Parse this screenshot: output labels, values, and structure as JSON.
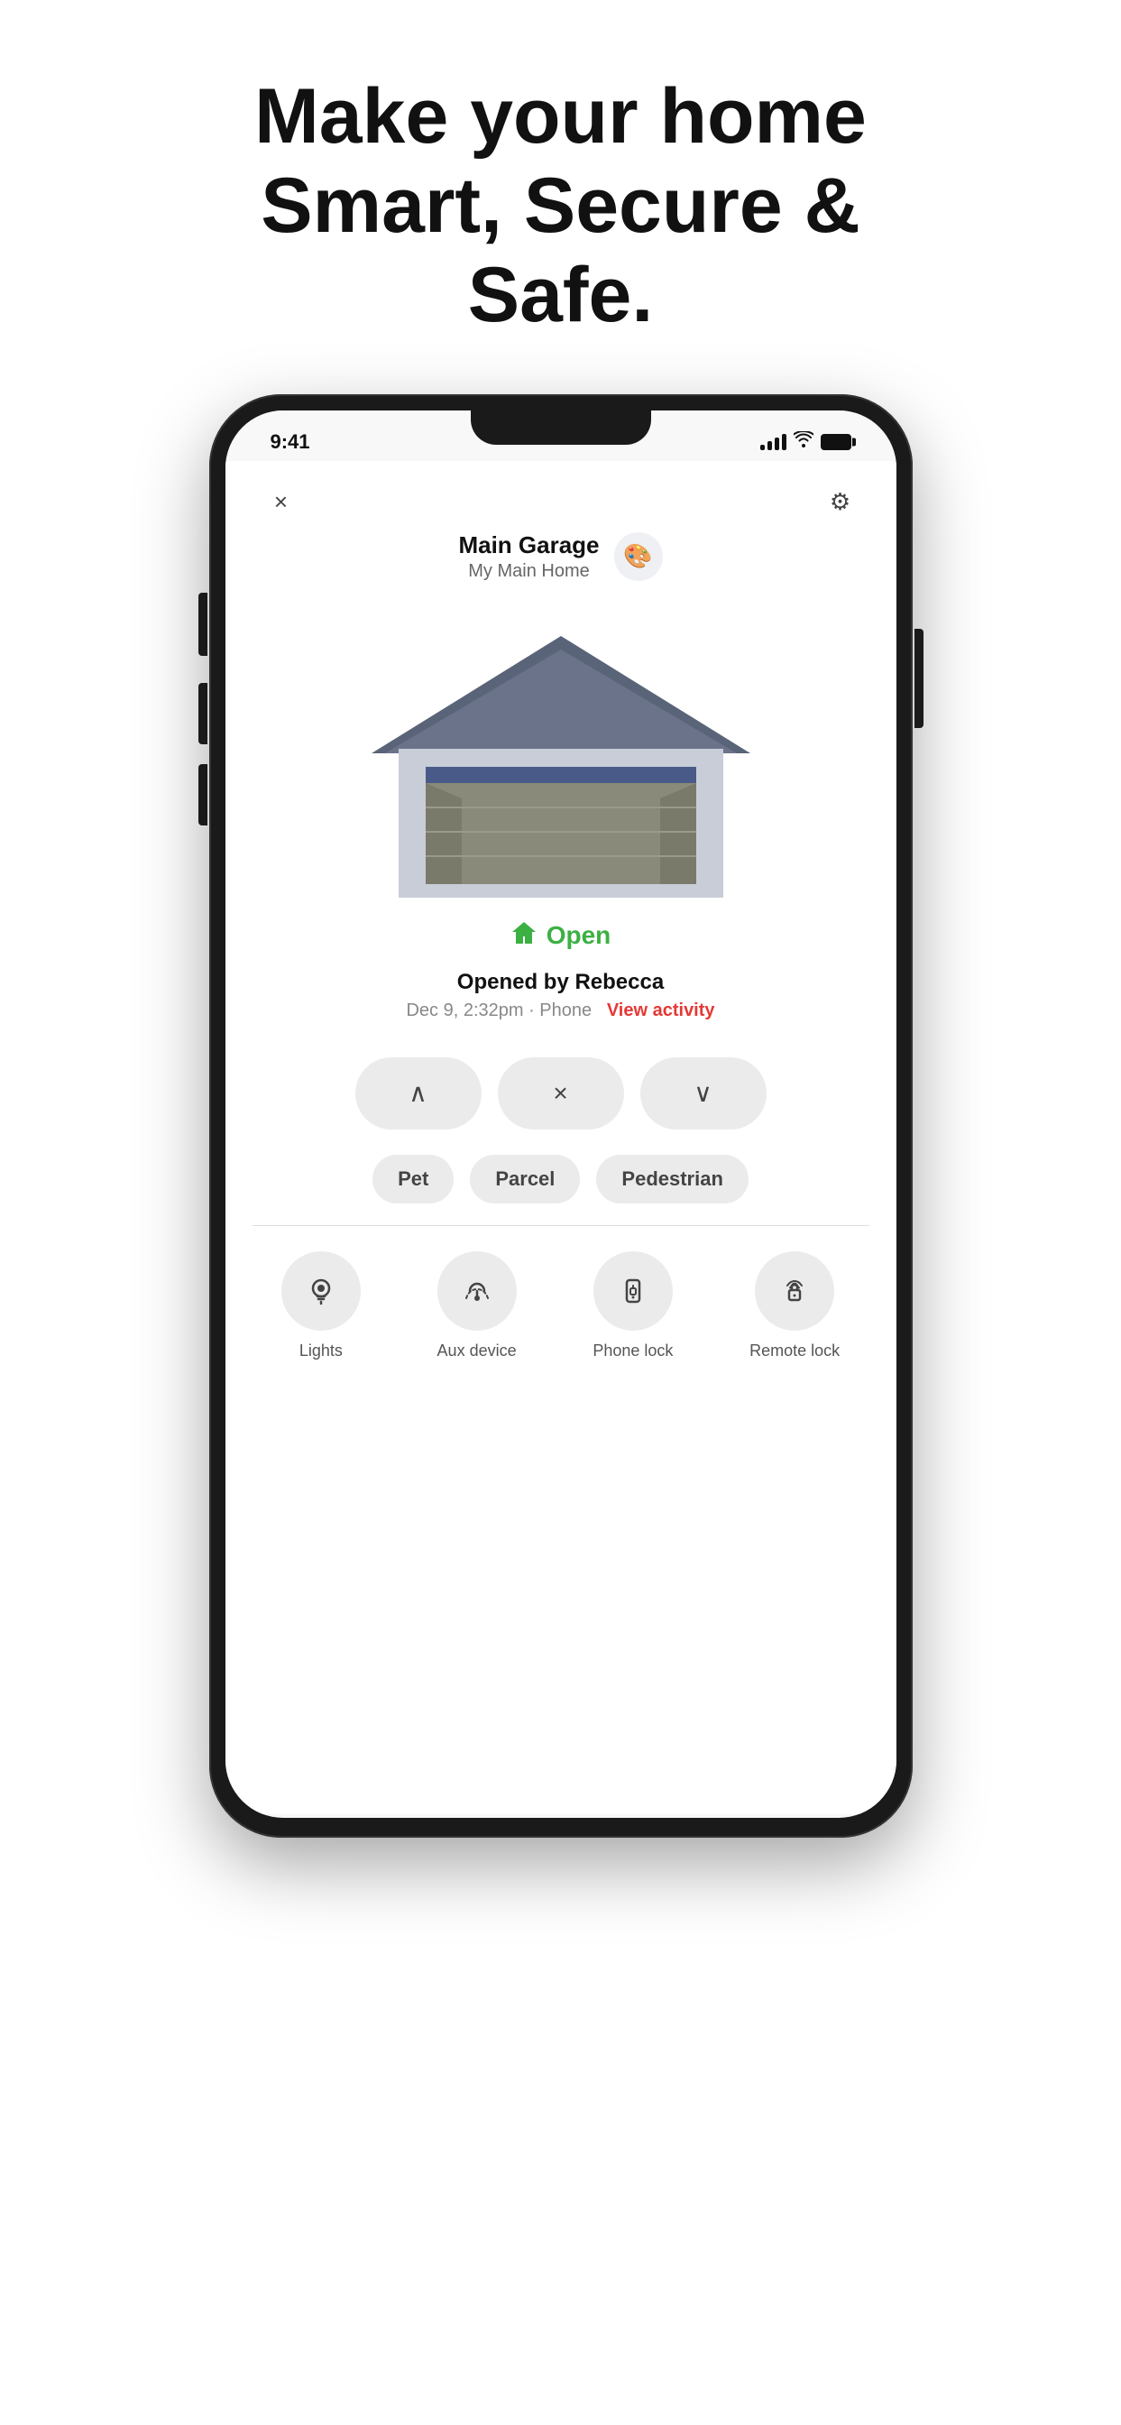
{
  "hero": {
    "heading": "Make your home Smart, Secure & Safe."
  },
  "status_bar": {
    "time": "9:41"
  },
  "nav": {
    "close_label": "×",
    "settings_label": "⚙"
  },
  "garage": {
    "name": "Main Garage",
    "location": "My Main Home",
    "avatar_icon": "🎨",
    "status": "Open",
    "opened_by": "Opened by Rebecca",
    "activity_time": "Dec 9, 2:32pm · Phone",
    "view_activity": "View activity"
  },
  "controls": {
    "up_label": "∧",
    "stop_label": "×",
    "down_label": "∨"
  },
  "modes": [
    {
      "label": "Pet"
    },
    {
      "label": "Parcel"
    },
    {
      "label": "Pedestrian"
    }
  ],
  "bottom_icons": [
    {
      "label": "Lights",
      "icon": "💡"
    },
    {
      "label": "Aux device",
      "icon": "🔄"
    },
    {
      "label": "Phone lock",
      "icon": "📱"
    },
    {
      "label": "Remote lock",
      "icon": "🔓"
    }
  ]
}
